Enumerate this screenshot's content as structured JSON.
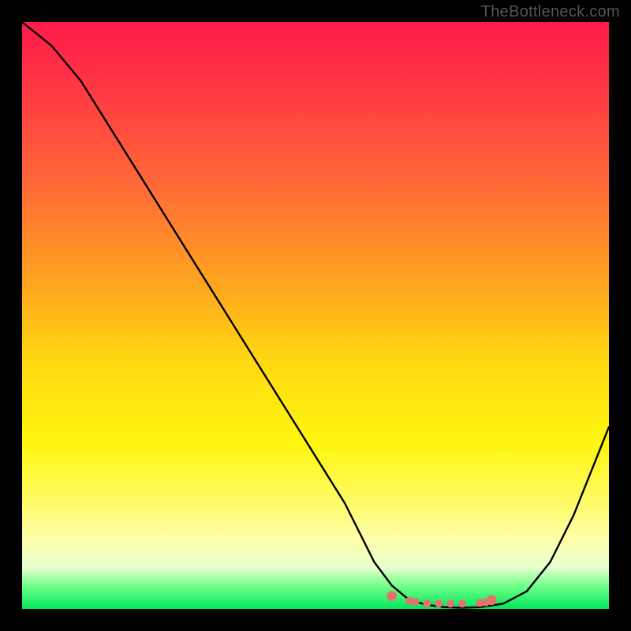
{
  "watermark": "TheBottleneck.com",
  "chart_data": {
    "type": "line",
    "title": "",
    "xlabel": "",
    "ylabel": "",
    "xlim": [
      0,
      100
    ],
    "ylim": [
      0,
      100
    ],
    "series": [
      {
        "name": "bottleneck-curve",
        "color": "#000000",
        "x": [
          0,
          5,
          10,
          15,
          20,
          25,
          30,
          35,
          40,
          45,
          50,
          55,
          58,
          60,
          63,
          66,
          69,
          72,
          75,
          78,
          82,
          86,
          90,
          94,
          98,
          100
        ],
        "y": [
          100,
          96,
          90,
          82,
          74,
          66,
          58,
          50,
          42,
          34,
          26,
          18,
          12,
          8,
          4,
          1.5,
          0.7,
          0.3,
          0.2,
          0.3,
          0.9,
          3,
          8,
          16,
          26,
          31
        ]
      },
      {
        "name": "bottleneck-markers",
        "color": "#e4736e",
        "x": [
          63,
          66,
          67,
          69,
          71,
          73,
          75,
          78,
          79,
          80
        ],
        "y": [
          2.2,
          1.4,
          1.2,
          0.9,
          0.9,
          0.9,
          0.9,
          1.0,
          1.1,
          1.5
        ]
      }
    ],
    "gradient_stops": [
      {
        "pos": 0,
        "color": "#ff1a4a"
      },
      {
        "pos": 12,
        "color": "#ff3a43"
      },
      {
        "pos": 28,
        "color": "#ff6a36"
      },
      {
        "pos": 44,
        "color": "#ffa320"
      },
      {
        "pos": 58,
        "color": "#ffd910"
      },
      {
        "pos": 72,
        "color": "#fff60f"
      },
      {
        "pos": 82,
        "color": "#fffb6a"
      },
      {
        "pos": 88,
        "color": "#fffea8"
      },
      {
        "pos": 93,
        "color": "#e6ffcf"
      },
      {
        "pos": 96,
        "color": "#73ff8a"
      },
      {
        "pos": 100,
        "color": "#00e85c"
      }
    ]
  }
}
